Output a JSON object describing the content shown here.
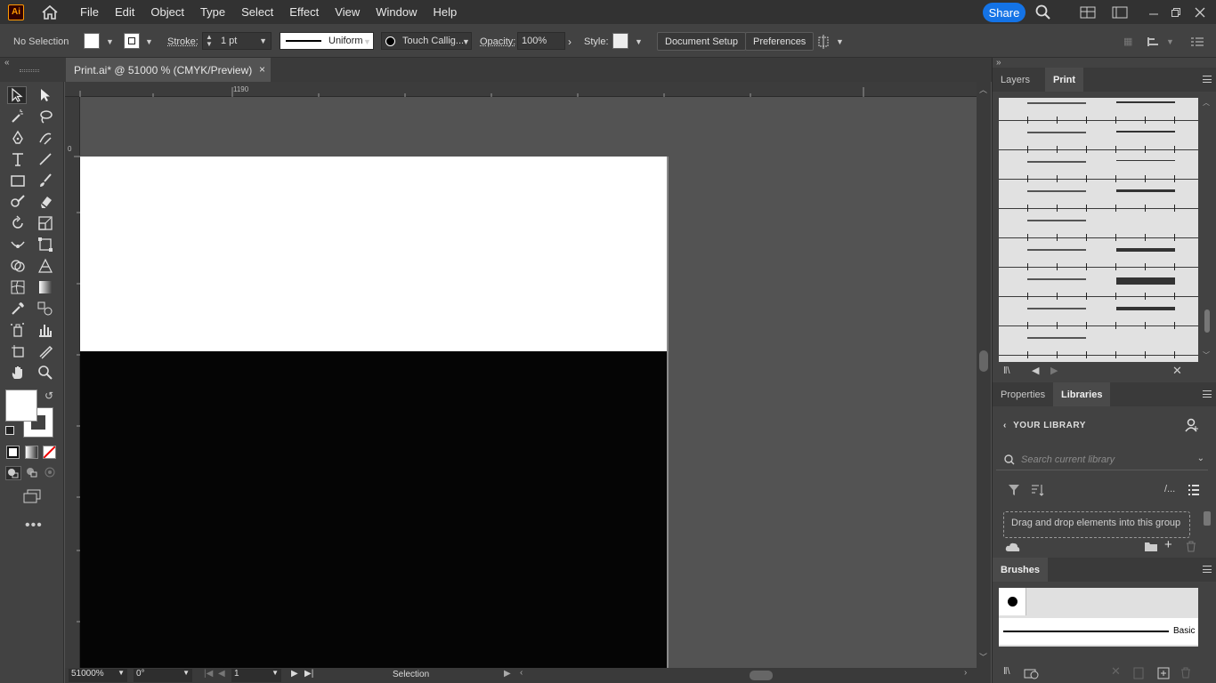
{
  "app": {
    "logo_text": "Ai",
    "share_label": "Share"
  },
  "menu": [
    "File",
    "Edit",
    "Object",
    "Type",
    "Select",
    "Effect",
    "View",
    "Window",
    "Help"
  ],
  "control_bar": {
    "selection": "No Selection",
    "stroke_label": "Stroke:",
    "stroke_weight": "1 pt",
    "profile": "Uniform",
    "brush": "Touch Callig...",
    "opacity_label": "Opacity:",
    "opacity_value": "100%",
    "style_label": "Style:",
    "document_setup": "Document Setup",
    "preferences": "Preferences"
  },
  "document": {
    "tab_title": "Print.ai* @ 51000 % (CMYK/Preview)",
    "close": "×"
  },
  "rulers": {
    "top_label": "1190",
    "left_label": "0"
  },
  "status_bar": {
    "zoom": "51000%",
    "rotation": "0°",
    "artboard": "1",
    "tool": "Selection"
  },
  "panels": {
    "top_tabs": [
      "Layers",
      "Print"
    ],
    "top_active": "Print",
    "mid_tabs": [
      "Properties",
      "Libraries"
    ],
    "mid_active": "Libraries",
    "library_heading": "YOUR LIBRARY",
    "library_search_placeholder": "Search current library",
    "dropzone_text": "Drag and drop elements into this group",
    "bottom_tab": "Brushes",
    "basic_brush_label": "Basic"
  },
  "colors": {
    "accent": "#1473e6",
    "app_bg": "#535353",
    "panel_bg": "#424242",
    "logo": "#ff9a00"
  }
}
